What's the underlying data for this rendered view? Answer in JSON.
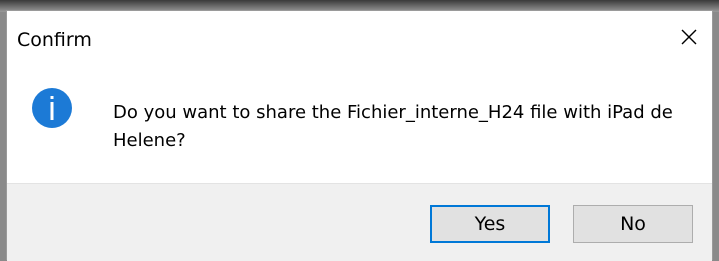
{
  "dialog": {
    "title": "Confirm",
    "close_icon": "close-icon",
    "message_icon": "info-icon",
    "message": "Do you want to share the Fichier_interne_H24 file with iPad de Helene?",
    "buttons": {
      "yes_label": "Yes",
      "no_label": "No",
      "default": "yes"
    }
  },
  "colors": {
    "info_icon": "#1c7ad6",
    "default_button_border": "#0078d7",
    "footer_background": "#f0f0f0"
  }
}
